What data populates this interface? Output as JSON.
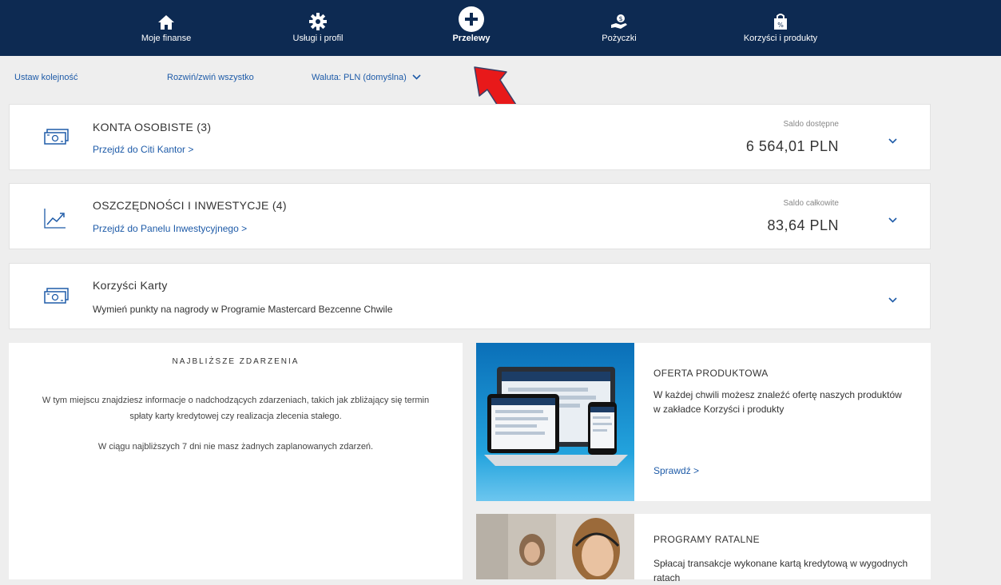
{
  "nav": {
    "items": [
      {
        "label": "Moje finanse",
        "icon": "home-icon"
      },
      {
        "label": "Usługi i profil",
        "icon": "gear-icon"
      },
      {
        "label": "Przelewy",
        "icon": "plus-circle-icon"
      },
      {
        "label": "Pożyczki",
        "icon": "money-hand-icon"
      },
      {
        "label": "Korzyści i produkty",
        "icon": "shopping-bag-icon"
      }
    ],
    "active": "Przelewy"
  },
  "toolbar": {
    "reorder": "Ustaw kolejność",
    "expand_collapse": "Rozwiń/zwiń wszystko",
    "currency": "Waluta: PLN (domyślna)"
  },
  "panels": {
    "personal": {
      "title": "KONTA OSOBISTE (3)",
      "link": "Przejdź do Citi Kantor >",
      "balance_label": "Saldo dostępne",
      "balance": "6 564,01 PLN"
    },
    "savings": {
      "title": "OSZCZĘDNOŚCI I INWESTYCJE (4)",
      "link": "Przejdź do Panelu Inwestycyjnego >",
      "balance_label": "Saldo całkowite",
      "balance": "83,64 PLN"
    },
    "card_benefits": {
      "title": "Korzyści Karty",
      "subtitle": "Wymień punkty na nagrody w Programie Mastercard Bezcenne Chwile"
    }
  },
  "events": {
    "title": "NAJBLIŻSZE ZDARZENIA",
    "text1": "W tym miejscu znajdziesz informacje o nadchodzących zdarzeniach, takich jak zbliżający się termin spłaty karty kredytowej czy realizacja zlecenia stałego.",
    "text2": "W ciągu najbliższych 7 dni nie masz żadnych zaplanowanych zdarzeń."
  },
  "offers": {
    "product": {
      "title": "OFERTA PRODUKTOWA",
      "text": "W każdej chwili możesz znaleźć ofertę naszych produktów w zakładce Korzyści i produkty",
      "link": "Sprawdź >"
    },
    "installments": {
      "title": "PROGRAMY RATALNE",
      "text": "Spłacaj transakcje wykonane kartą kredytową w wygodnych ratach"
    }
  },
  "colors": {
    "nav_bg": "#0d2a52",
    "link": "#1e5ba8",
    "annotation_arrow": "#e8191a"
  }
}
